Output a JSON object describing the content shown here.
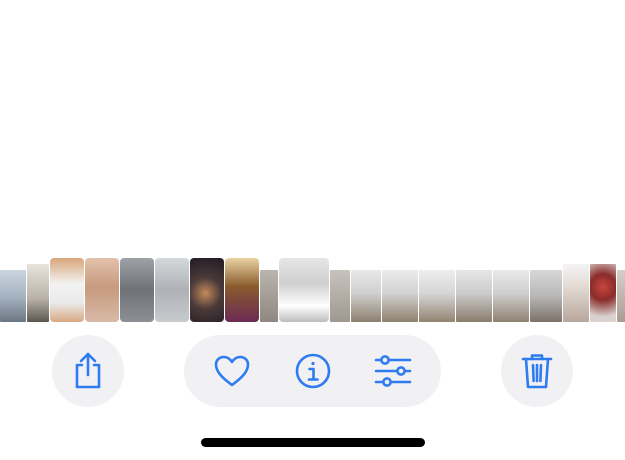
{
  "viewer": {
    "accent_color": "#2f7bf0",
    "toolbar_background": "#f1f1f3"
  },
  "film_strip": {
    "thumbnail_count": 23
  },
  "toolbar": {
    "share_icon": "share-icon",
    "favorite_icon": "heart-icon",
    "info_icon": "info-icon",
    "adjust_icon": "adjust-sliders-icon",
    "delete_icon": "trash-icon"
  }
}
